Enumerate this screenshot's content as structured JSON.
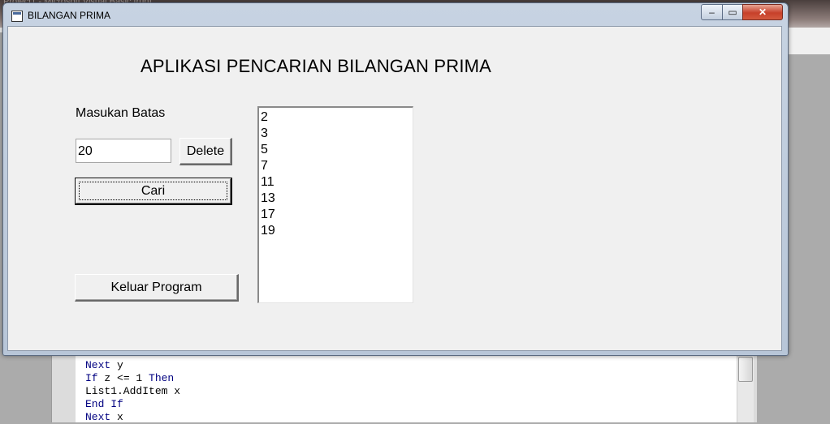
{
  "ide": {
    "title": "Project1 - Microsoft Visual Basic [run]",
    "code_lines": [
      {
        "kw": "Next",
        "rest": " y"
      },
      {
        "kw": "If",
        "rest": " z <= 1 ",
        "kw2": "Then"
      },
      {
        "kw": "",
        "rest": "List1.AddItem x"
      },
      {
        "kw": "End If",
        "rest": ""
      },
      {
        "kw": "Next",
        "rest": " x"
      }
    ]
  },
  "window": {
    "title": "BILANGAN PRIMA",
    "minimize": "‒",
    "maximize": "▭",
    "close": "✕"
  },
  "form": {
    "heading": "APLIKASI PENCARIAN BILANGAN PRIMA",
    "batas_label": "Masukan Batas",
    "batas_value": "20",
    "delete_label": "Delete",
    "cari_label": "Cari",
    "keluar_label": "Keluar Program",
    "results": [
      "2",
      "3",
      "5",
      "7",
      "11",
      "13",
      "17",
      "19"
    ]
  },
  "colors": {
    "form_bg": "#f0f0f0",
    "code_keyword": "#000080",
    "close_button": "#c7402a"
  }
}
